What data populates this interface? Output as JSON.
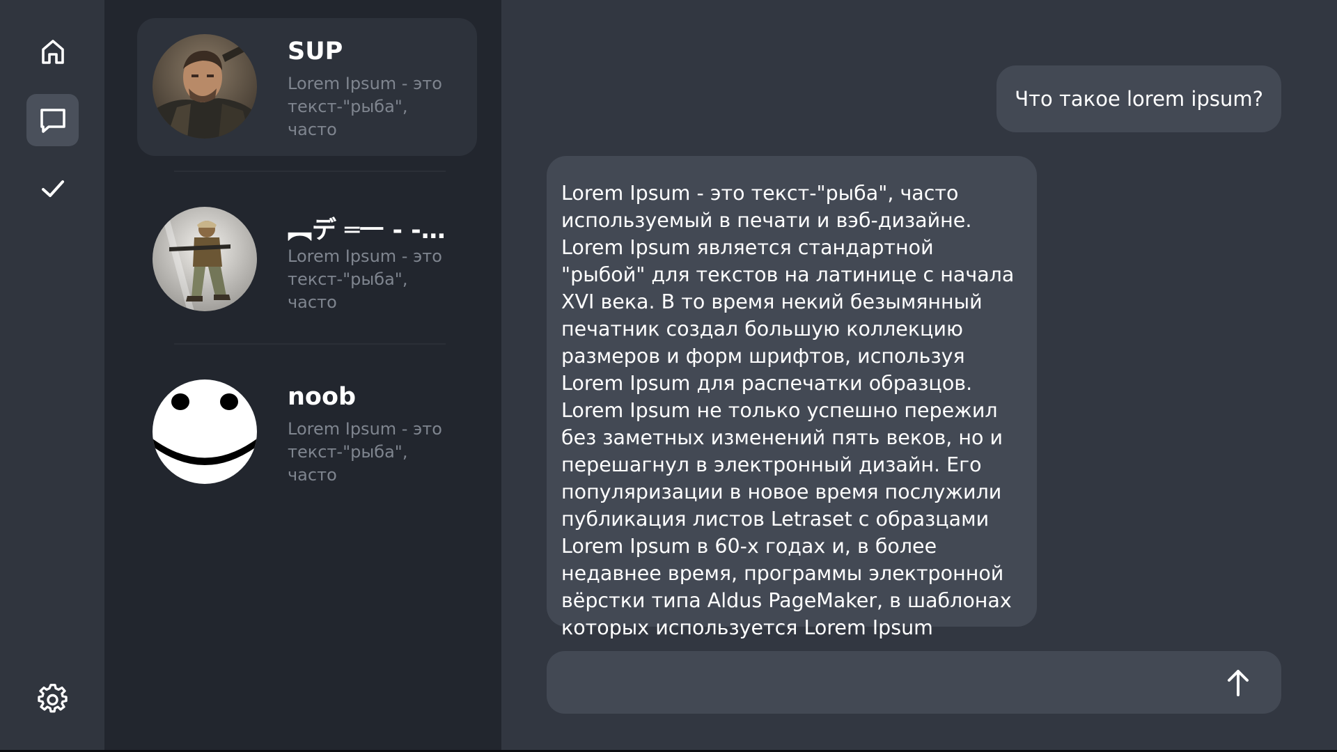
{
  "nav": {
    "items": [
      {
        "icon": "home-icon",
        "active": false
      },
      {
        "icon": "chat-bubble-icon",
        "active": true
      },
      {
        "icon": "checkmark-icon",
        "active": false
      }
    ],
    "settings_icon": "gear-icon"
  },
  "chats": [
    {
      "name": "SUP",
      "preview": "Lorem Ipsum - это текст-\"рыба\", часто используемый в ...",
      "avatar": "soldier-avatar",
      "active": true
    },
    {
      "name": "︻デ ═一 - - ...",
      "preview": "Lorem Ipsum - это текст-\"рыба\", часто используемый в ...",
      "avatar": "gunman-avatar",
      "active": false
    },
    {
      "name": "noob",
      "preview": "Lorem Ipsum - это текст-\"рыба\", часто используемый в ...",
      "avatar": "smiley-avatar",
      "active": false
    }
  ],
  "conversation": {
    "messages": [
      {
        "role": "user",
        "text": "Что такое lorem ipsum?"
      },
      {
        "role": "assistant",
        "text": "Lorem Ipsum - это текст-\"рыба\", часто используемый в печати и вэб-дизайне. Lorem Ipsum является стандартной \"рыбой\" для текстов на латинице с начала XVI века. В то время некий безымянный печатник создал большую коллекцию размеров и форм шрифтов, используя Lorem Ipsum для распечатки образцов. Lorem Ipsum не только успешно пережил без заметных изменений пять веков, но и перешагнул в электронный дизайн. Его популяризации в новое время послужили публикация листов Letraset с образцами Lorem Ipsum в 60-х годах и, в более недавнее время, программы электронной вёрстки типа Aldus PageMaker, в шаблонах которых используется Lorem Ipsum"
      }
    ],
    "composer": {
      "value": "",
      "placeholder": "",
      "send_icon": "arrow-up-icon"
    }
  },
  "colors": {
    "background": "#323741",
    "nav_rail": "#30353e",
    "chat_list": "#22262e",
    "bubble": "#434954",
    "preview_text": "#7f858f"
  }
}
